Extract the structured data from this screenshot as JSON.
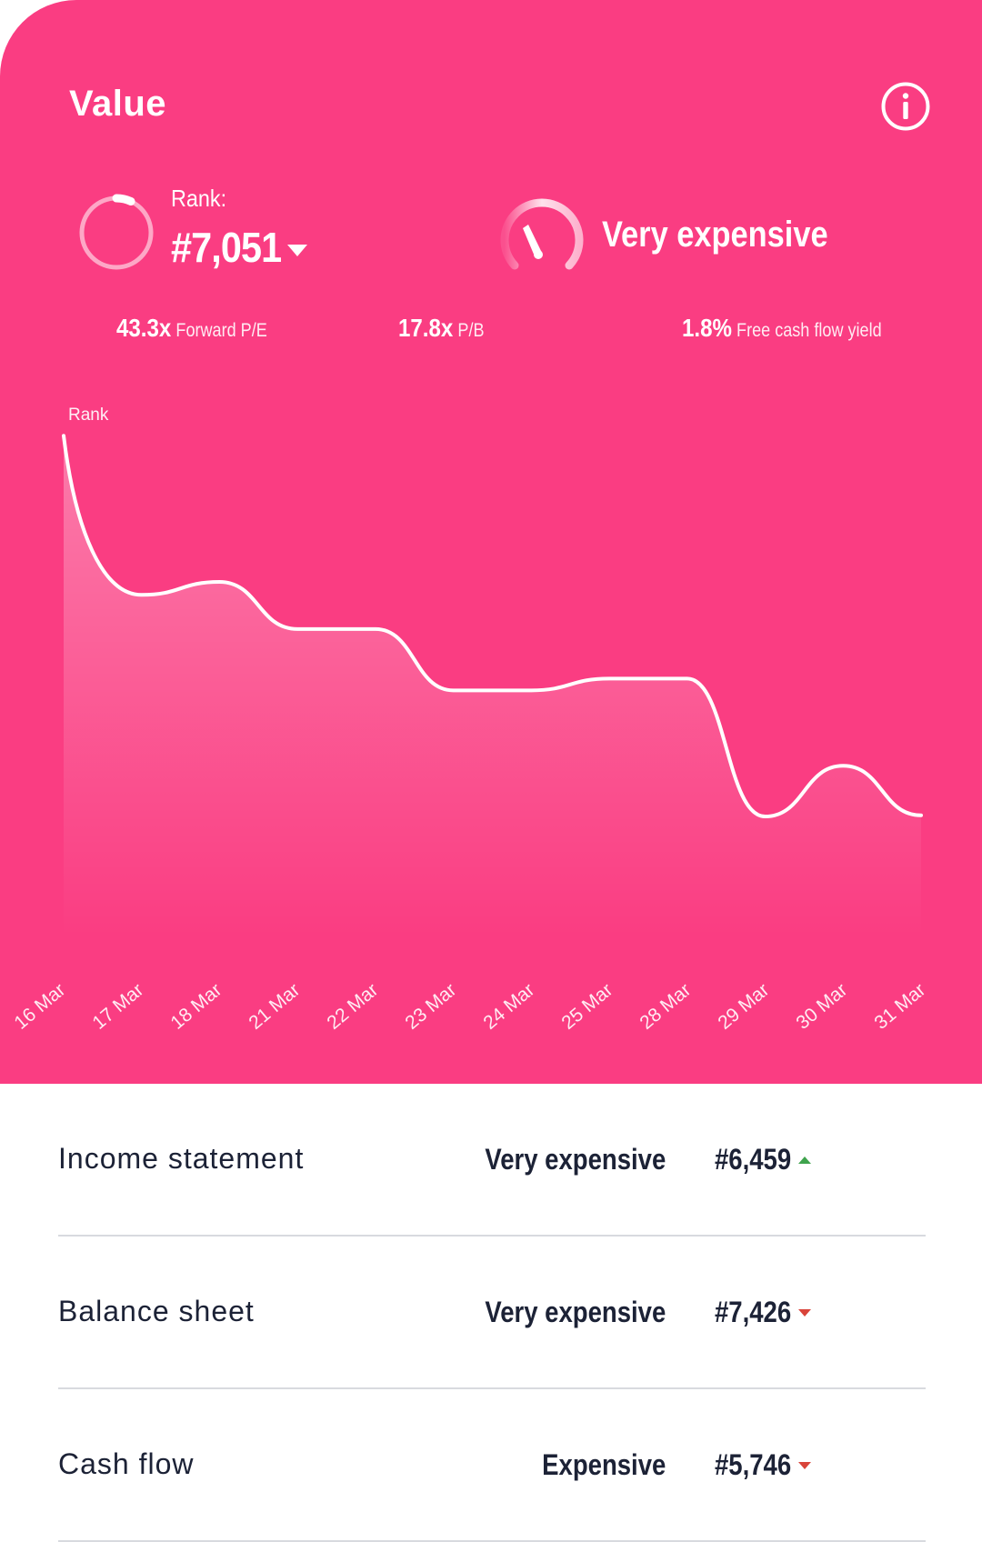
{
  "theme": {
    "accent": "#fa3d82",
    "up": "#3fa34d",
    "down": "#d9443a"
  },
  "header": {
    "title": "Value",
    "info_icon": "info-circle-icon"
  },
  "rank": {
    "label": "Rank:",
    "value": "#7,051",
    "trend": "down"
  },
  "valuation": {
    "label": "Very expensive"
  },
  "metrics": [
    {
      "value": "43.3x",
      "label": "Forward P/E"
    },
    {
      "value": "17.8x",
      "label": "P/B"
    },
    {
      "value": "1.8%",
      "label": "Free cash flow yield"
    }
  ],
  "chart_data": {
    "type": "area",
    "ylabel": "Rank",
    "categories": [
      "16 Mar",
      "17 Mar",
      "18 Mar",
      "21 Mar",
      "22 Mar",
      "23 Mar",
      "24 Mar",
      "25 Mar",
      "28 Mar",
      "29 Mar",
      "30 Mar",
      "31 Mar"
    ],
    "series": [
      {
        "values": [
          4580,
          5930,
          5820,
          6220,
          6220,
          6740,
          6740,
          6640,
          6640,
          7810,
          7380,
          7800
        ]
      }
    ],
    "ylim": [
      4200,
      10000
    ],
    "y_inverted": true,
    "grid": false,
    "legend": "none"
  },
  "breakdown": [
    {
      "name": "Income statement",
      "verdict": "Very expensive",
      "rank": "#6,459",
      "trend": "up"
    },
    {
      "name": "Balance sheet",
      "verdict": "Very expensive",
      "rank": "#7,426",
      "trend": "down"
    },
    {
      "name": "Cash flow",
      "verdict": "Expensive",
      "rank": "#5,746",
      "trend": "down"
    }
  ]
}
